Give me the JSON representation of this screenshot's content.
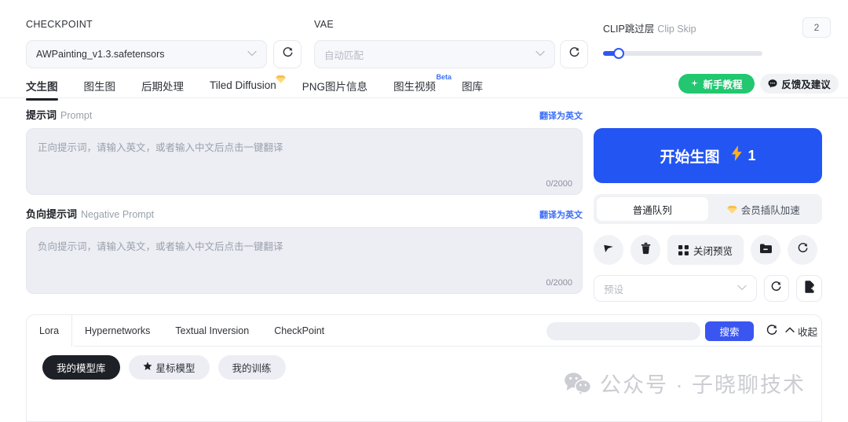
{
  "topbar": {
    "checkpoint_label": "CHECKPOINT",
    "checkpoint_value": "AWPainting_v1.3.safetensors",
    "vae_label": "VAE",
    "vae_placeholder": "自动匹配",
    "refresh_icon": "refresh-icon",
    "clip_skip_zh": "CLIP跳过层",
    "clip_skip_en": "Clip Skip",
    "clip_skip_value": "2"
  },
  "tabs": [
    {
      "label": "文生图",
      "active": true,
      "badge": ""
    },
    {
      "label": "图生图",
      "active": false,
      "badge": ""
    },
    {
      "label": "后期处理",
      "active": false,
      "badge": ""
    },
    {
      "label": "Tiled Diffusion",
      "active": false,
      "badge": "gem"
    },
    {
      "label": "PNG图片信息",
      "active": false,
      "badge": ""
    },
    {
      "label": "图生视频",
      "active": false,
      "badge": "Beta"
    },
    {
      "label": "图库",
      "active": false,
      "badge": ""
    }
  ],
  "header_buttons": {
    "tutorial": "新手教程",
    "feedback": "反馈及建议"
  },
  "prompt": {
    "label_zh": "提示词",
    "label_en": "Prompt",
    "translate": "翻译为英文",
    "placeholder": "正向提示词，请输入英文，或者输入中文后点击一键翻译",
    "counter": "0/2000"
  },
  "negative_prompt": {
    "label_zh": "负向提示词",
    "label_en": "Negative Prompt",
    "translate": "翻译为英文",
    "placeholder": "负向提示词，请输入英文，或者输入中文后点击一键翻译",
    "counter": "0/2000"
  },
  "generate": {
    "label": "开始生图",
    "count": "1",
    "bolt_icon": "bolt-icon"
  },
  "queue": {
    "normal": "普通队列",
    "vip": "会员插队加速"
  },
  "action_icons": {
    "send": "send-icon",
    "delete": "trash-icon",
    "preview_label": "关闭预览",
    "grid_icon": "grid-icon",
    "folder": "folder-minus-icon",
    "refresh": "refresh-icon"
  },
  "preset": {
    "placeholder": "预设",
    "refresh_icon": "refresh-icon",
    "add_icon": "file-plus-icon"
  },
  "model_panel": {
    "tabs": [
      {
        "label": "Lora",
        "active": true
      },
      {
        "label": "Hypernetworks",
        "active": false
      },
      {
        "label": "Textual Inversion",
        "active": false
      },
      {
        "label": "CheckPoint",
        "active": false
      }
    ],
    "search_value": "",
    "search_button": "搜索",
    "refresh_icon": "refresh-icon",
    "collapse_label": "收起",
    "chips": [
      {
        "label": "我的模型库",
        "selected": true,
        "icon": ""
      },
      {
        "label": "星标模型",
        "selected": false,
        "icon": "star-icon"
      },
      {
        "label": "我的训练",
        "selected": false,
        "icon": ""
      }
    ]
  },
  "watermark": {
    "text": "公众号 · 子晓聊技术",
    "icon": "wechat-icon"
  },
  "colors": {
    "primary_blue": "#2355f2",
    "search_blue": "#3b56f0",
    "green": "#22c770",
    "dark": "#1d2026",
    "field_bg": "#eceef4",
    "link_blue": "#3b6ef5"
  }
}
